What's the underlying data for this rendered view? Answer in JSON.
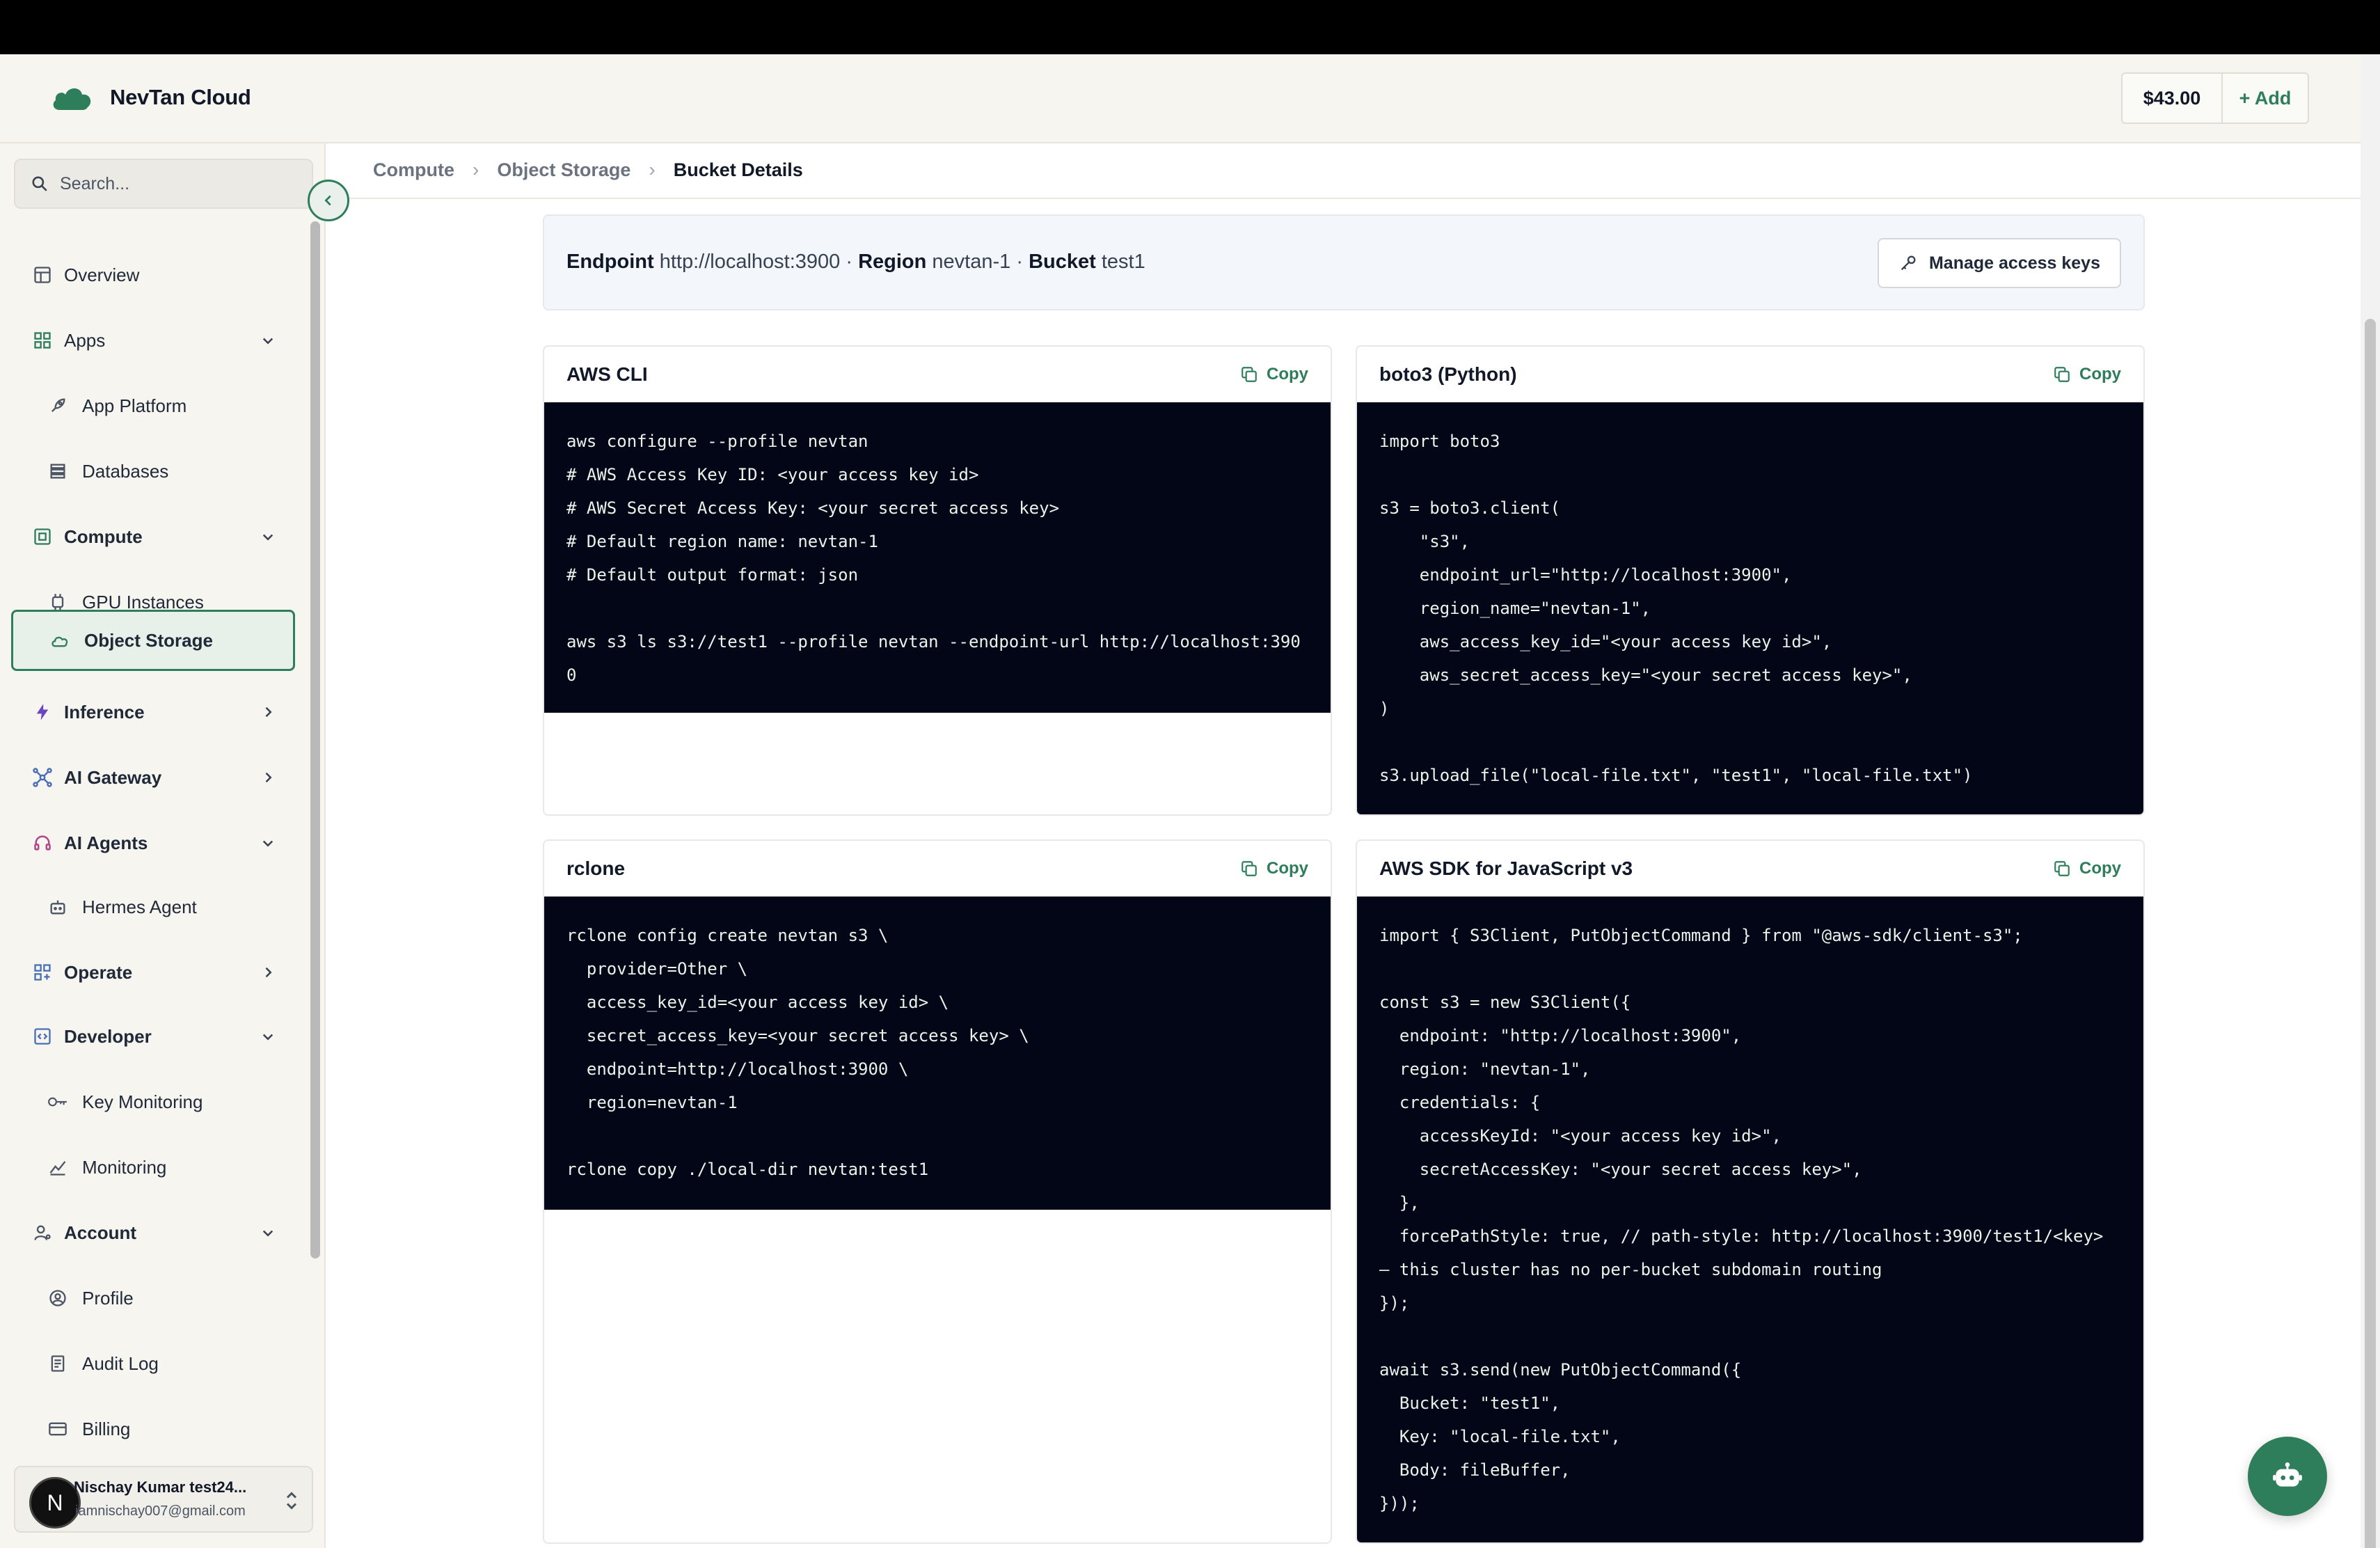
{
  "app": {
    "name": "NevTan Cloud"
  },
  "header": {
    "balance": "$43.00",
    "add_label": "+ Add"
  },
  "sidebar": {
    "search_placeholder": "Search...",
    "items": {
      "overview": "Overview",
      "apps": "Apps",
      "app_platform": "App Platform",
      "databases": "Databases",
      "compute": "Compute",
      "gpu_instances": "GPU Instances",
      "object_storage": "Object Storage",
      "inference": "Inference",
      "ai_gateway": "AI Gateway",
      "ai_agents": "AI Agents",
      "hermes_agent": "Hermes Agent",
      "operate": "Operate",
      "developer": "Developer",
      "key_monitoring": "Key Monitoring",
      "monitoring": "Monitoring",
      "account": "Account",
      "profile": "Profile",
      "audit_log": "Audit Log",
      "billing": "Billing"
    },
    "user": {
      "initial": "N",
      "name": "Nischay Kumar test24...",
      "email": "iamnischay007@gmail.com"
    }
  },
  "breadcrumb": {
    "compute": "Compute",
    "object_storage": "Object Storage",
    "current": "Bucket Details"
  },
  "info": {
    "endpoint_label": "Endpoint",
    "endpoint_value": "http://localhost:3900",
    "region_label": "Region",
    "region_value": "nevtan-1",
    "bucket_label": "Bucket",
    "bucket_value": "test1",
    "separator": "·",
    "manage_keys": "Manage access keys"
  },
  "snippets": {
    "copy_label": "Copy",
    "aws_cli": {
      "title": "AWS CLI",
      "code": "aws configure --profile nevtan\n# AWS Access Key ID: <your access key id>\n# AWS Secret Access Key: <your secret access key>\n# Default region name: nevtan-1\n# Default output format: json\n\naws s3 ls s3://test1 --profile nevtan --endpoint-url http://localhost:3900"
    },
    "boto3": {
      "title": "boto3 (Python)",
      "code": "import boto3\n\ns3 = boto3.client(\n    \"s3\",\n    endpoint_url=\"http://localhost:3900\",\n    region_name=\"nevtan-1\",\n    aws_access_key_id=\"<your access key id>\",\n    aws_secret_access_key=\"<your secret access key>\",\n)\n\ns3.upload_file(\"local-file.txt\", \"test1\", \"local-file.txt\")"
    },
    "rclone": {
      "title": "rclone",
      "code": "rclone config create nevtan s3 \\\n  provider=Other \\\n  access_key_id=<your access key id> \\\n  secret_access_key=<your secret access key> \\\n  endpoint=http://localhost:3900 \\\n  region=nevtan-1\n\nrclone copy ./local-dir nevtan:test1"
    },
    "js_sdk": {
      "title": "AWS SDK for JavaScript v3",
      "code": "import { S3Client, PutObjectCommand } from \"@aws-sdk/client-s3\";\n\nconst s3 = new S3Client({\n  endpoint: \"http://localhost:3900\",\n  region: \"nevtan-1\",\n  credentials: {\n    accessKeyId: \"<your access key id>\",\n    secretAccessKey: \"<your secret access key>\",\n  },\n  forcePathStyle: true, // path-style: http://localhost:3900/test1/<key>\n— this cluster has no per-bucket subdomain routing\n});\n\nawait s3.send(new PutObjectCommand({\n  Bucket: \"test1\",\n  Key: \"local-file.txt\",\n  Body: fileBuffer,\n}));"
    }
  },
  "colors": {
    "accent": "#2e7d5b",
    "code_bg": "#030617",
    "code_fg": "#e8f3ea"
  }
}
